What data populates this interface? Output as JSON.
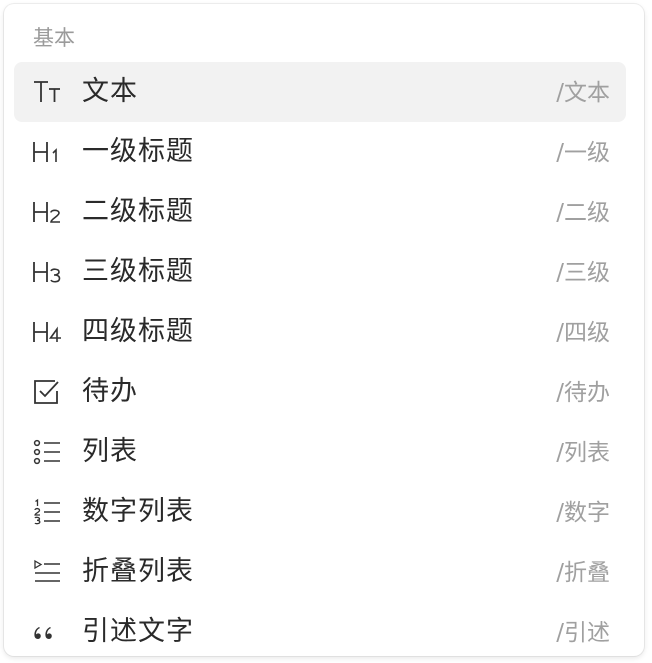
{
  "menu": {
    "section_title": "基本",
    "items": [
      {
        "icon": "text-size-icon",
        "label": "文本",
        "shortcut": "/文本",
        "selected": true
      },
      {
        "icon": "heading-1-icon",
        "label": "一级标题",
        "shortcut": "/一级"
      },
      {
        "icon": "heading-2-icon",
        "label": "二级标题",
        "shortcut": "/二级"
      },
      {
        "icon": "heading-3-icon",
        "label": "三级标题",
        "shortcut": "/三级"
      },
      {
        "icon": "heading-4-icon",
        "label": "四级标题",
        "shortcut": "/四级"
      },
      {
        "icon": "checkbox-icon",
        "label": "待办",
        "shortcut": "/待办"
      },
      {
        "icon": "bullet-list-icon",
        "label": "列表",
        "shortcut": "/列表"
      },
      {
        "icon": "numbered-list-icon",
        "label": "数字列表",
        "shortcut": "/数字"
      },
      {
        "icon": "toggle-list-icon",
        "label": "折叠列表",
        "shortcut": "/折叠"
      },
      {
        "icon": "quote-icon",
        "label": "引述文字",
        "shortcut": "/引述"
      }
    ]
  },
  "colors": {
    "selected_background": "#f2f2f2",
    "label_text": "#2a2a2a",
    "muted_text": "#a0a0a0"
  }
}
